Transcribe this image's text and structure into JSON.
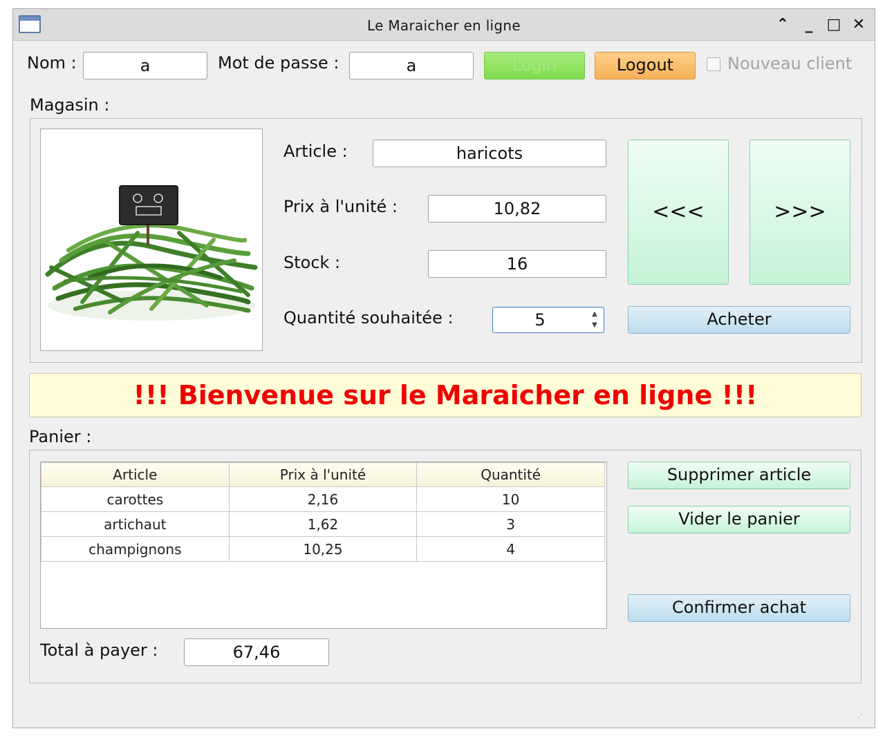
{
  "window": {
    "title": "Le Maraicher en ligne",
    "controls": {
      "collapse": "⌃",
      "minimize": "_",
      "maximize": "□",
      "close": "✕"
    }
  },
  "login": {
    "name_label": "Nom :",
    "name_value": "a",
    "password_label": "Mot de passe :",
    "password_value": "a",
    "login_button": "Login",
    "logout_button": "Logout",
    "new_client_label": "Nouveau client"
  },
  "store": {
    "section_label": "Magasin :",
    "article_label": "Article :",
    "article_value": "haricots",
    "price_label": "Prix à l'unité :",
    "price_value": "10,82",
    "stock_label": "Stock :",
    "stock_value": "16",
    "quantity_label": "Quantité souhaitée :",
    "quantity_value": "5",
    "prev_button": "<<<",
    "next_button": ">>>",
    "buy_button": "Acheter"
  },
  "banner": {
    "message": "!!! Bienvenue sur le Maraicher en ligne !!!"
  },
  "cart": {
    "section_label": "Panier :",
    "columns": [
      "Article",
      "Prix à l'unité",
      "Quantité"
    ],
    "rows": [
      [
        "carottes",
        "2,16",
        "10"
      ],
      [
        "artichaut",
        "1,62",
        "3"
      ],
      [
        "champignons",
        "10,25",
        "4"
      ]
    ],
    "delete_button": "Supprimer article",
    "empty_button": "Vider le panier",
    "confirm_button": "Confirmer achat",
    "total_label": "Total à payer :",
    "total_value": "67,46"
  },
  "colors": {
    "banner_text": "#f00000",
    "banner_bg": "#fffdd8",
    "login_button": "#7edc4c",
    "logout_button": "#f7b057"
  }
}
